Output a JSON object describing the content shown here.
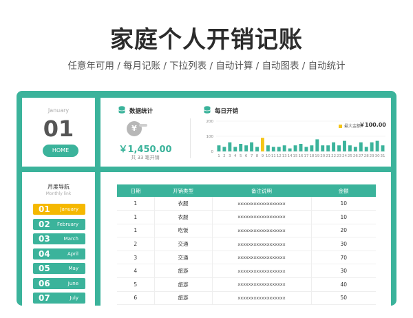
{
  "header": {
    "title": "家庭个人开销记账",
    "subtitle": "任意年可用 / 每月记账 / 下拉列表 / 自动计算 / 自动图表 / 自动统计"
  },
  "date_card": {
    "month": "January",
    "day": "01",
    "home_label": "HOME"
  },
  "stats": {
    "title": "数据统计",
    "total": "￥1,450.00",
    "count_text": "共 33 笔开销",
    "coin_symbol": "¥"
  },
  "daily": {
    "title": "每日开销",
    "max_label": "最大金额",
    "max_value": "￥100.00"
  },
  "chart_data": {
    "type": "bar",
    "categories": [
      "1",
      "2",
      "3",
      "4",
      "5",
      "6",
      "7",
      "8",
      "9",
      "10",
      "11",
      "12",
      "13",
      "14",
      "15",
      "16",
      "17",
      "18",
      "19",
      "20",
      "21",
      "22",
      "23",
      "24",
      "25",
      "26",
      "27",
      "28",
      "29",
      "30",
      "31"
    ],
    "values": [
      40,
      30,
      60,
      30,
      50,
      40,
      60,
      30,
      90,
      40,
      30,
      30,
      40,
      20,
      40,
      50,
      30,
      40,
      80,
      40,
      40,
      60,
      40,
      70,
      40,
      30,
      60,
      30,
      60,
      70,
      40
    ],
    "highlight_index": 8,
    "highlight_color": "#f5c518",
    "bar_color": "#3bb39b",
    "yticks": [
      0,
      100,
      200
    ],
    "ylim": [
      0,
      200
    ]
  },
  "nav": {
    "title": "月度导航",
    "subtitle": "Monthly link",
    "items": [
      {
        "num": "01",
        "name": "January",
        "active": true
      },
      {
        "num": "02",
        "name": "February"
      },
      {
        "num": "03",
        "name": "March"
      },
      {
        "num": "04",
        "name": "April"
      },
      {
        "num": "05",
        "name": "May"
      },
      {
        "num": "06",
        "name": "June"
      },
      {
        "num": "07",
        "name": "July"
      }
    ]
  },
  "table": {
    "headers": [
      "日期",
      "开销类型",
      "备注说明",
      "金额"
    ],
    "rows": [
      [
        "1",
        "衣服",
        "xxxxxxxxxxxxxxxxxx",
        "10"
      ],
      [
        "1",
        "衣服",
        "xxxxxxxxxxxxxxxxxx",
        "10"
      ],
      [
        "1",
        "吃饭",
        "xxxxxxxxxxxxxxxxxx",
        "20"
      ],
      [
        "2",
        "交通",
        "xxxxxxxxxxxxxxxxxx",
        "30"
      ],
      [
        "3",
        "交通",
        "xxxxxxxxxxxxxxxxxx",
        "70"
      ],
      [
        "4",
        "旅游",
        "xxxxxxxxxxxxxxxxxx",
        "30"
      ],
      [
        "5",
        "旅游",
        "xxxxxxxxxxxxxxxxxx",
        "40"
      ],
      [
        "6",
        "旅游",
        "xxxxxxxxxxxxxxxxxx",
        "50"
      ]
    ]
  }
}
